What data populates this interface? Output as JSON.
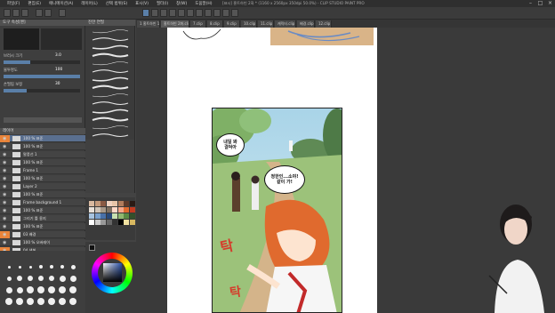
{
  "app": {
    "title": "[표시] 홍트하빈 2화 * (1160 x 2560px 350dpi 50.0%) - CLIP STUDIO PAINT PRO",
    "menu": [
      "파일(F)",
      "편집(E)",
      "애니메이션(A)",
      "레이어(L)",
      "선택 범위(S)",
      "표시(V)",
      "필터(I)",
      "창(W)",
      "도움말(H)"
    ]
  },
  "tabs": [
    {
      "label": "1 홍트하빈 1화.clip"
    },
    {
      "label": "홍트하빈 2화.clip"
    },
    {
      "label": "7.clip"
    },
    {
      "label": "8.clip"
    },
    {
      "label": "9.clip"
    },
    {
      "label": "10.clip"
    },
    {
      "label": "11.clip"
    },
    {
      "label": "캐릭터.clip"
    },
    {
      "label": "배경.clip"
    },
    {
      "label": "12.clip"
    }
  ],
  "left_panel": {
    "header": "도구 속성[펜]",
    "props": [
      {
        "label": "브러시 크기",
        "value": "3.0"
      },
      {
        "label": "불투명도",
        "value": "100"
      },
      {
        "label": "손떨림 보정",
        "value": "30"
      }
    ],
    "layer_header": "레이어",
    "layers": [
      {
        "label": "100 % 표준",
        "selected": true
      },
      {
        "label": "100 % 표준",
        "selected": false
      },
      {
        "label": "말풍선 1",
        "selected": false
      },
      {
        "label": "100 % 표준",
        "selected": false
      },
      {
        "label": "Frame 1",
        "selected": false
      },
      {
        "label": "100 % 표준",
        "selected": false
      },
      {
        "label": "Layer 2",
        "selected": false
      },
      {
        "label": "100 % 표준",
        "selected": false
      },
      {
        "label": "Frame background 1",
        "selected": false
      },
      {
        "label": "100 % 표준",
        "selected": false
      },
      {
        "label": "그리기 틀 용지",
        "selected": false
      },
      {
        "label": "100 % 표준",
        "selected": false
      },
      {
        "label": "03 배경",
        "selected": false
      },
      {
        "label": "100 % 오버레이",
        "selected": false
      },
      {
        "label": "04 색칠",
        "selected": false
      },
      {
        "label": "100 % 표준",
        "selected": false
      },
      {
        "label": "Layer 8",
        "selected": false
      },
      {
        "label": "100 % 표준",
        "selected": false
      }
    ]
  },
  "brush_panel": {
    "header": "진한 연필"
  },
  "comic": {
    "bubble1": "내일 봐\n결덕아",
    "bubble2": "정한인...소야!\n같이 가!",
    "sfx": "탁"
  },
  "colors": {
    "accent": "#5a7fa8",
    "orange": "#e9843a",
    "panel": "#3e3e3e"
  }
}
